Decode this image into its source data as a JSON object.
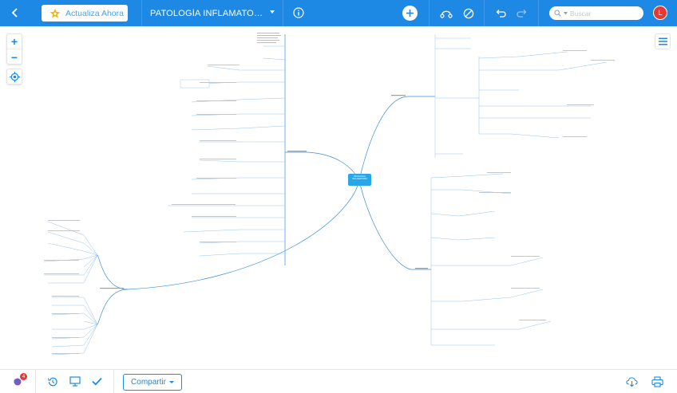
{
  "topbar": {
    "upgrade_label": "Actualiza Ahora",
    "document_title": "PATOLOGÍA INFLAMATORIA I...",
    "search_placeholder": "Buscar",
    "avatar_initial": "L",
    "icons": [
      "back-icon",
      "star-icon",
      "caret-down-icon",
      "info-icon",
      "plus-icon",
      "style-icon",
      "no-edit-icon",
      "undo-icon",
      "redo-icon",
      "search-icon"
    ]
  },
  "canvas": {
    "root_label": "PATOLOGÍA INFLAMATORIA",
    "zoom_in_label": "+",
    "zoom_out_label": "−"
  },
  "bottombar": {
    "chat_badge_count": "4",
    "share_label": "Compartir",
    "icons": [
      "chat-icon",
      "history-icon",
      "present-icon",
      "check-icon",
      "download-icon",
      "print-icon"
    ]
  },
  "colors": {
    "primary": "#1e88e5",
    "badge": "#e53935",
    "root_node": "#29a6e8"
  }
}
